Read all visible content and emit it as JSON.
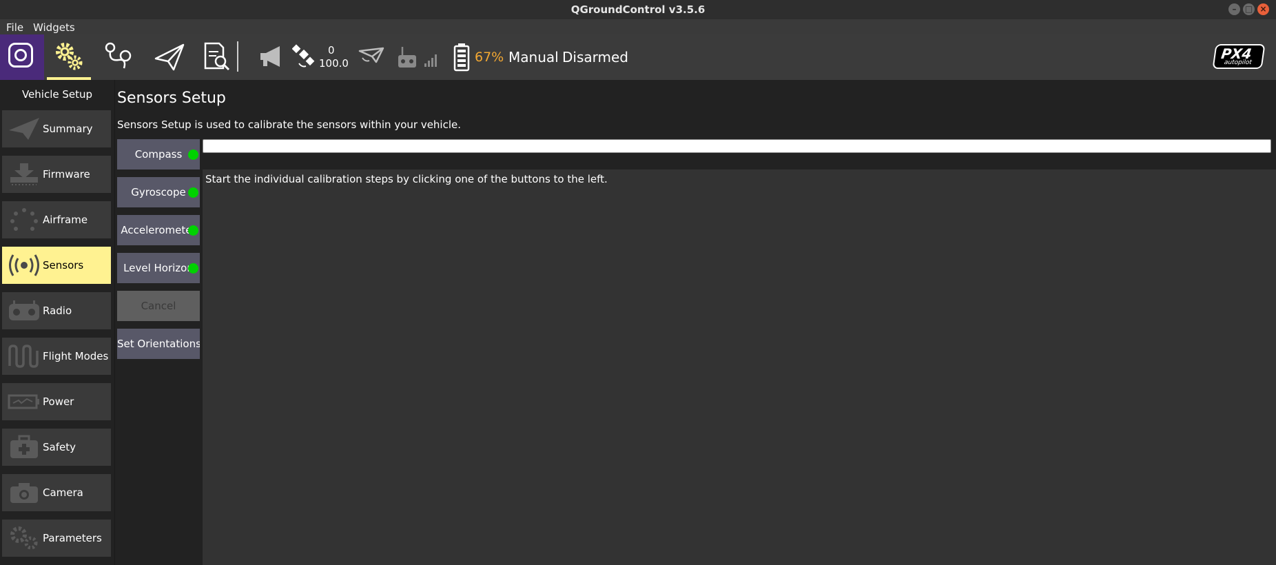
{
  "window": {
    "title": "QGroundControl v3.5.6"
  },
  "menu": {
    "file": "File",
    "widgets": "Widgets"
  },
  "toolbar": {
    "gps_count": "0",
    "gps_hdop": "100.0",
    "battery": "67%",
    "flight_mode": "Manual",
    "arm_state": "Disarmed",
    "battery_color": "#f2a833",
    "logo_bg": "#4a2a7a",
    "active_underline": "#fff291"
  },
  "sidebar": {
    "header": "Vehicle Setup",
    "items": [
      {
        "label": "Summary",
        "icon": "paper-plane-icon"
      },
      {
        "label": "Firmware",
        "icon": "download-icon"
      },
      {
        "label": "Airframe",
        "icon": "airframe-icon"
      },
      {
        "label": "Sensors",
        "icon": "sensors-icon",
        "selected": true
      },
      {
        "label": "Radio",
        "icon": "radio-icon"
      },
      {
        "label": "Flight Modes",
        "icon": "wave-icon"
      },
      {
        "label": "Power",
        "icon": "battery-icon"
      },
      {
        "label": "Safety",
        "icon": "medkit-icon"
      },
      {
        "label": "Camera",
        "icon": "camera-icon"
      },
      {
        "label": "Parameters",
        "icon": "gears-icon"
      }
    ]
  },
  "main": {
    "title": "Sensors Setup",
    "description": "Sensors Setup is used to calibrate the sensors within your vehicle.",
    "buttons": {
      "compass": "Compass",
      "gyroscope": "Gyroscope",
      "accelerometer": "Accelerometer",
      "level_horizon": "Level Horizon",
      "cancel": "Cancel",
      "set_orientations": "Set Orientations"
    },
    "status_message": "Start the individual calibration steps by clicking one of the buttons to the left.",
    "status_dot_color": "#00d200"
  }
}
